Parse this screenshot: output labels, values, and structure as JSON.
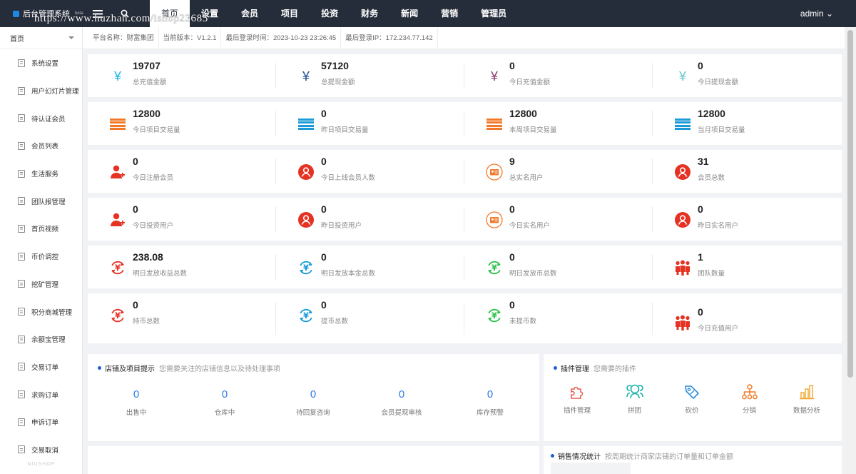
{
  "app": {
    "title": "后台管理系统",
    "badge": "beta",
    "watermark": "https://www.huzhan.com/ishop23685",
    "brand_footer": "NIUSHOP"
  },
  "topnav": {
    "items": [
      "首页",
      "设置",
      "会员",
      "项目",
      "投资",
      "财务",
      "新闻",
      "营销",
      "管理员"
    ],
    "active_index": 0,
    "user": "admin ⌄"
  },
  "sidebar": {
    "header": "首页",
    "items": [
      "系统设置",
      "用户幻灯片管理",
      "待认证会员",
      "会员列表",
      "生活服务",
      "团队报管理",
      "首页视频",
      "币价调控",
      "挖矿管理",
      "积分商城管理",
      "余额宝管理",
      "交易订单",
      "求购订单",
      "申诉订单",
      "交易取消"
    ]
  },
  "infobar": {
    "platform": "平台名称：财富集团",
    "version": "当前版本：V1.2.1",
    "last_login": "最后登录时间：2023-10-23 23:26:45",
    "last_ip": "最后登录IP：172.234.77.142"
  },
  "stats": [
    [
      {
        "value": "19707",
        "label": "总充值金额",
        "icon": "yen-icon",
        "color": "#1fb8e8"
      },
      {
        "value": "57120",
        "label": "总提现金额",
        "icon": "yen-icon",
        "color": "#1d4f8c"
      },
      {
        "value": "0",
        "label": "今日充值金额",
        "icon": "yen-icon",
        "color": "#8a3a6a"
      },
      {
        "value": "0",
        "label": "今日提现金额",
        "icon": "yen-icon",
        "color": "#66c8cc"
      }
    ],
    [
      {
        "value": "12800",
        "label": "今日项目交易量",
        "icon": "list-icon",
        "color": "#f07a2a"
      },
      {
        "value": "0",
        "label": "昨日项目交易量",
        "icon": "list-icon",
        "color": "#1a9ad6"
      },
      {
        "value": "12800",
        "label": "本周项目交易量",
        "icon": "list-icon",
        "color": "#f07a2a"
      },
      {
        "value": "12800",
        "label": "当月项目交易量",
        "icon": "list-icon",
        "color": "#1a9ad6"
      }
    ],
    [
      {
        "value": "0",
        "label": "今日注册会员",
        "icon": "add-user-icon",
        "color": "#e53222"
      },
      {
        "value": "0",
        "label": "今日上线会员人数",
        "icon": "user-circle-icon",
        "color": "#e53222"
      },
      {
        "value": "9",
        "label": "总实名用户",
        "icon": "id-card-icon",
        "color": "#f07a2a"
      },
      {
        "value": "31",
        "label": "会员总数",
        "icon": "user-circle-icon",
        "color": "#e53222"
      }
    ],
    [
      {
        "value": "0",
        "label": "今日投资用户",
        "icon": "add-user-icon",
        "color": "#e53222"
      },
      {
        "value": "0",
        "label": "昨日投资用户",
        "icon": "user-circle-icon",
        "color": "#e53222"
      },
      {
        "value": "0",
        "label": "今日实名用户",
        "icon": "id-card-icon",
        "color": "#f07a2a"
      },
      {
        "value": "0",
        "label": "昨日实名用户",
        "icon": "user-circle-icon",
        "color": "#e53222"
      }
    ],
    [
      {
        "value": "238.08",
        "label": "明日发放收益总数",
        "icon": "yen-cycle-icon",
        "color": "#e53222"
      },
      {
        "value": "0",
        "label": "明日发放本金总数",
        "icon": "yen-cycle-icon",
        "color": "#1a9ad6"
      },
      {
        "value": "0",
        "label": "明日发放币总数",
        "icon": "yen-cycle-icon",
        "color": "#2bc24a"
      },
      {
        "value": "1",
        "label": "团队数量",
        "icon": "team-icon",
        "color": "#e53222"
      }
    ],
    [
      {
        "value": "0",
        "label": "持币总数",
        "icon": "yen-cycle-icon",
        "color": "#e53222"
      },
      {
        "value": "0",
        "label": "提币总数",
        "icon": "yen-cycle-icon",
        "color": "#1a9ad6"
      },
      {
        "value": "0",
        "label": "未提币数",
        "icon": "yen-cycle-icon",
        "color": "#2bc24a"
      },
      {
        "value": "0",
        "label": "今日充值用户",
        "icon": "team-icon",
        "color": "#e53222"
      }
    ]
  ],
  "shop_panel": {
    "title": "店铺及项目提示",
    "subtitle": "您需要关注的店铺信息以及待处理事项",
    "items": [
      {
        "value": "0",
        "label": "出售中"
      },
      {
        "value": "0",
        "label": "仓库中"
      },
      {
        "value": "0",
        "label": "待回复咨询"
      },
      {
        "value": "0",
        "label": "会员提现审核"
      },
      {
        "value": "0",
        "label": "库存预警"
      }
    ]
  },
  "plugin_panel": {
    "title": "插件管理",
    "subtitle": "您需要的插件",
    "items": [
      {
        "label": "插件管理",
        "icon": "puzzle-icon",
        "color": "#e8584e"
      },
      {
        "label": "拼团",
        "icon": "group-icon",
        "color": "#18b3a8"
      },
      {
        "label": "砍价",
        "icon": "tag-icon",
        "color": "#2a8cdc"
      },
      {
        "label": "分销",
        "icon": "network-icon",
        "color": "#f07a2a"
      },
      {
        "label": "数据分析",
        "icon": "bar-chart-icon",
        "color": "#f0a62a"
      }
    ]
  },
  "sales_panel": {
    "title": "销售情况统计",
    "subtitle": "按周期统计商家店铺的订单量和订单金额"
  }
}
